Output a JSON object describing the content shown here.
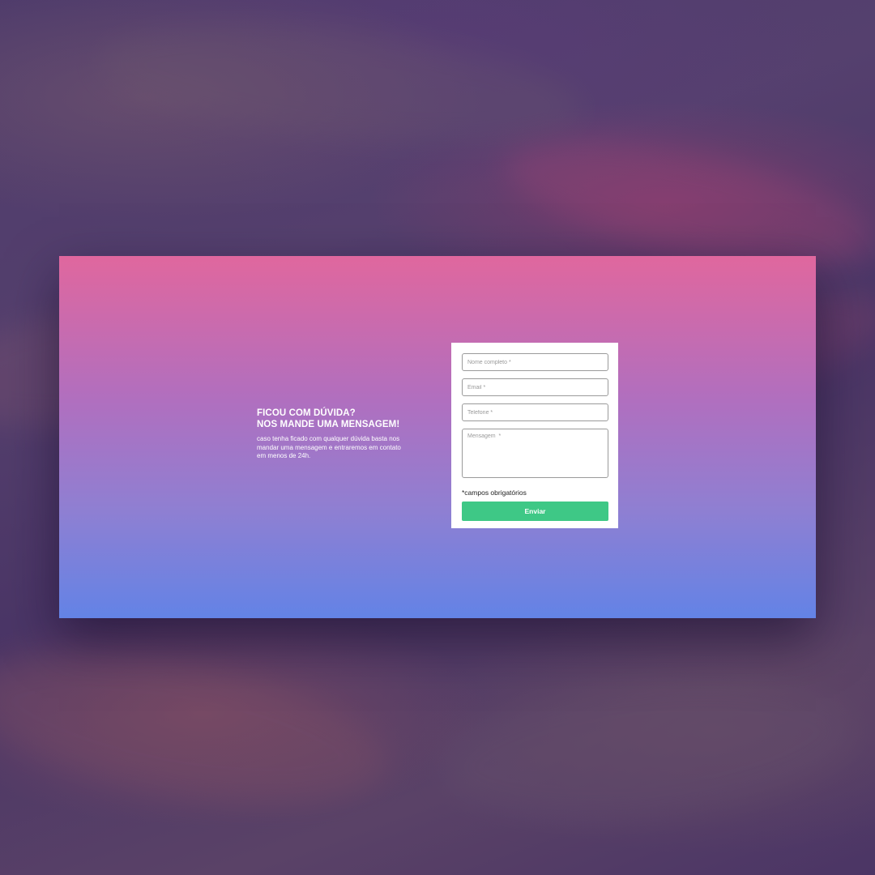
{
  "intro": {
    "headline_line1": "FICOU COM DÚVIDA?",
    "headline_line2": "NOS MANDE UMA MENSAGEM!",
    "body": "caso tenha ficado com qualquer dúvida basta nos mandar uma mensagem e entraremos em contato em menos de 24h."
  },
  "form": {
    "name_placeholder": "Nome completo *",
    "email_placeholder": "Email *",
    "phone_placeholder": "Telefone *",
    "message_placeholder": "Mensagem  *",
    "required_note": "*campos obrigatórios",
    "submit_label": "Enviar"
  },
  "colors": {
    "gradient_top": "#e0679e",
    "gradient_bottom": "#6383e6",
    "submit_button": "#3ec886",
    "background": "#4d3a6b"
  }
}
